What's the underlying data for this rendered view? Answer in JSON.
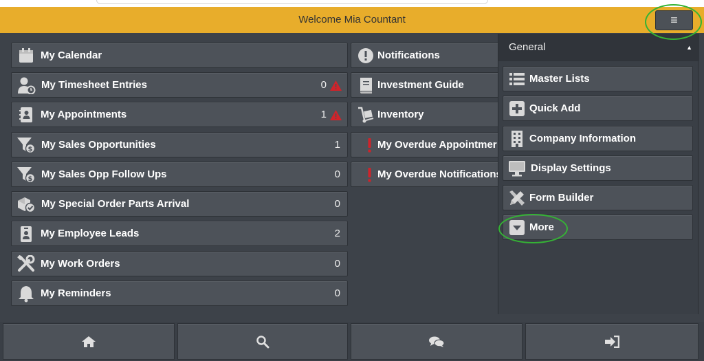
{
  "header": {
    "title": "Welcome Mia Countant",
    "menu_icon": "≡"
  },
  "tiles_left": [
    {
      "label": "My Calendar",
      "count": "",
      "icon": "calendar-icon"
    },
    {
      "label": "My Timesheet Entries",
      "count": "0",
      "icon": "timesheet-icon",
      "alert": true
    },
    {
      "label": "My Appointments",
      "count": "1",
      "icon": "appointments-icon",
      "alert": true
    },
    {
      "label": "My Sales Opportunities",
      "count": "1",
      "icon": "funnel-dollar-icon"
    },
    {
      "label": "My Sales Opp Follow Ups",
      "count": "0",
      "icon": "funnel-dollar-icon"
    },
    {
      "label": "My Special Order Parts Arrival",
      "count": "0",
      "icon": "parts-check-icon"
    },
    {
      "label": "My Employee Leads",
      "count": "2",
      "icon": "employee-badge-icon"
    },
    {
      "label": "My Work Orders",
      "count": "0",
      "icon": "tools-icon"
    },
    {
      "label": "My Reminders",
      "count": "0",
      "icon": "bell-icon"
    }
  ],
  "tiles_mid": [
    {
      "label": "Notifications",
      "icon": "exclamation-circle-icon"
    },
    {
      "label": "Investment Guide",
      "icon": "book-icon"
    },
    {
      "label": "Inventory",
      "icon": "hand-truck-icon"
    },
    {
      "label": "My Overdue Appointmer",
      "icon": "exclamation-icon"
    },
    {
      "label": "My Overdue Notifications",
      "icon": "exclamation-icon"
    }
  ],
  "panel": {
    "title": "General",
    "caret": "▲",
    "items": [
      {
        "label": "Master Lists",
        "icon": "list-icon"
      },
      {
        "label": "Quick Add",
        "icon": "plus-icon"
      },
      {
        "label": "Company Information",
        "icon": "building-icon"
      },
      {
        "label": "Display Settings",
        "icon": "monitor-icon"
      },
      {
        "label": "Form Builder",
        "icon": "pencil-ruler-icon"
      },
      {
        "label": "More",
        "icon": "caret-down-box-icon"
      }
    ]
  },
  "bottom_nav": [
    {
      "name": "home",
      "icon": "home-icon"
    },
    {
      "name": "search",
      "icon": "search-icon"
    },
    {
      "name": "chat",
      "icon": "chat-icon"
    },
    {
      "name": "logout",
      "icon": "logout-icon"
    }
  ],
  "colors": {
    "header_bg": "#e8ad2b",
    "tile_bg": "#4d5259",
    "panel_bg": "#3a3f46",
    "alert_red": "#d0232a",
    "highlight_ring": "#35b335"
  }
}
